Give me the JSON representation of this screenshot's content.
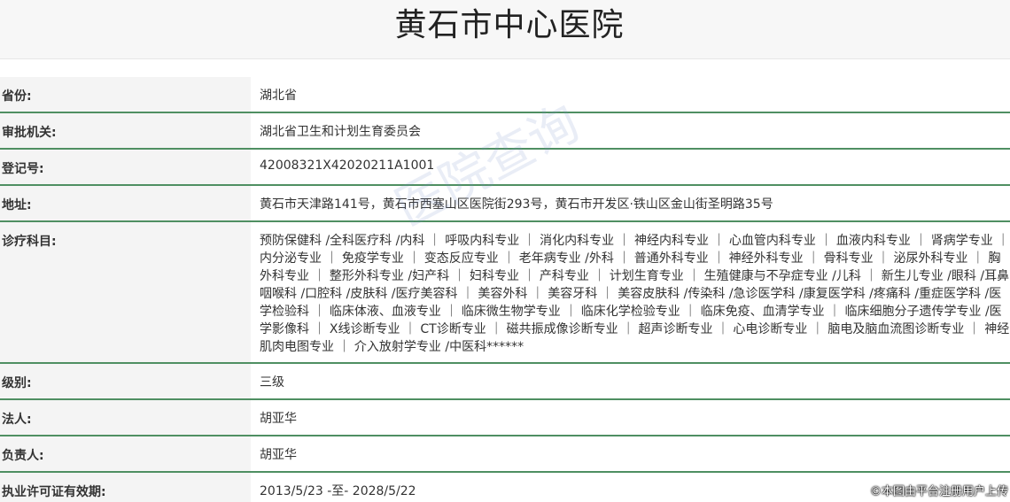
{
  "title": "黄石市中心医院",
  "rows": [
    {
      "label": "省份:",
      "value": "湖北省"
    },
    {
      "label": "审批机关:",
      "value": "湖北省卫生和计划生育委员会"
    },
    {
      "label": "登记号:",
      "value": "42008321X42020211A1001"
    },
    {
      "label": "地址:",
      "value": "黄石市天津路141号，黄石市西塞山区医院街293号，黄石市开发区·铁山区金山街圣明路35号"
    },
    {
      "label": "诊疗科目:",
      "value": "预防保健科 /全科医疗科 /内科 ｜ 呼吸内科专业 ｜ 消化内科专业 ｜ 神经内科专业 ｜ 心血管内科专业 ｜ 血液内科专业 ｜ 肾病学专业 ｜ 内分泌专业 ｜ 免疫学专业 ｜ 变态反应专业 ｜ 老年病专业 /外科 ｜ 普通外科专业 ｜ 神经外科专业 ｜ 骨科专业 ｜ 泌尿外科专业 ｜ 胸外科专业 ｜ 整形外科专业 /妇产科 ｜ 妇科专业 ｜ 产科专业 ｜ 计划生育专业 ｜ 生殖健康与不孕症专业 /儿科 ｜ 新生儿专业 /眼科 /耳鼻咽喉科 /口腔科 /皮肤科 /医疗美容科 ｜ 美容外科 ｜ 美容牙科 ｜ 美容皮肤科 /传染科 /急诊医学科 /康复医学科 /疼痛科 /重症医学科 /医学检验科 ｜ 临床体液、血液专业 ｜ 临床微生物学专业 ｜ 临床化学检验专业 ｜ 临床免疫、血清学专业 ｜ 临床细胞分子遗传学专业 /医学影像科 ｜ X线诊断专业 ｜ CT诊断专业 ｜ 磁共振成像诊断专业 ｜ 超声诊断专业 ｜ 心电诊断专业 ｜ 脑电及脑血流图诊断专业 ｜ 神经肌肉电图专业 ｜ 介入放射学专业 /中医科******"
    },
    {
      "label": "级别:",
      "value": "三级"
    },
    {
      "label": "法人:",
      "value": "胡亚华"
    },
    {
      "label": "负责人:",
      "value": "胡亚华"
    },
    {
      "label": "执业许可证有效期:",
      "value": "2013/5/23 -至- 2028/5/22"
    }
  ],
  "watermark": "医院查询",
  "credit": "©本图由平台注册用户上传"
}
